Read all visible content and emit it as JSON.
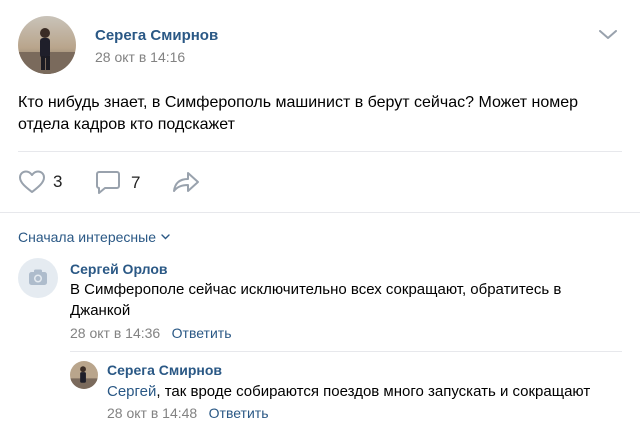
{
  "post": {
    "author": "Серега Смирнов",
    "date": "28 окт в 14:16",
    "text": "Кто нибудь знает, в Симферополь машинист в берут сейчас? Может номер отдела кадров кто подскажет",
    "likes": "3",
    "comments": "7"
  },
  "sort": {
    "label": "Сначала интересные"
  },
  "comments": [
    {
      "author": "Сергей Орлов",
      "text": "В Симферополе сейчас исключительно всех сокращают, обратитесь в Джанкой",
      "date": "28 окт в 14:36",
      "reply_label": "Ответить"
    },
    {
      "author": "Серега Смирнов",
      "mention": "Сергей",
      "text": ", так вроде собираются поездов много запускать и сокращают",
      "date": "28 окт в 14:48",
      "reply_label": "Ответить"
    }
  ],
  "colors": {
    "link": "#2a5885",
    "meta": "#828282",
    "icon": "#99a2ad",
    "divider": "#e7e8ec"
  }
}
